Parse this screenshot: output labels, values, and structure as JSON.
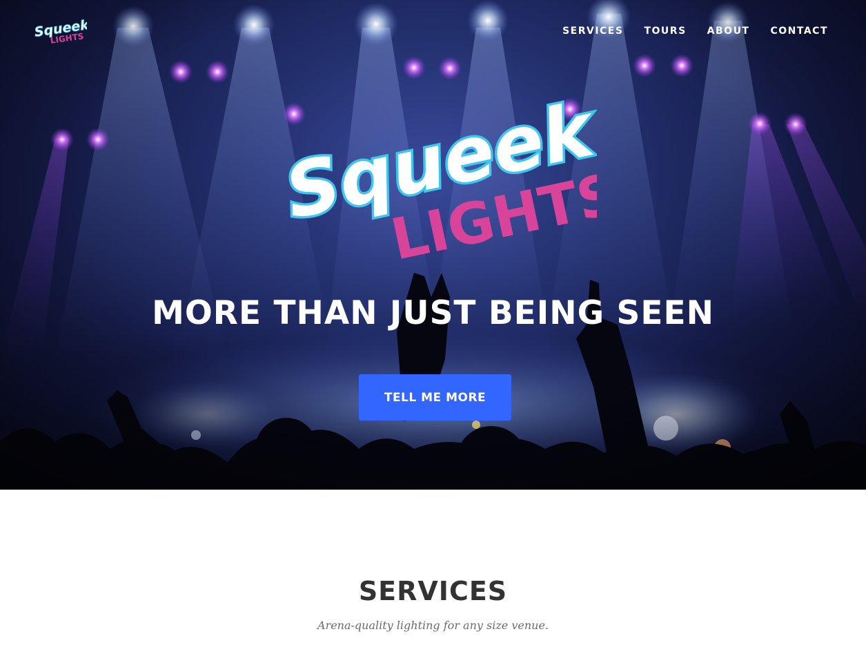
{
  "nav": {
    "logo": {
      "word1": "Squeek",
      "word2": "LIGHTS"
    },
    "links": [
      {
        "label": "SERVICES"
      },
      {
        "label": "TOURS"
      },
      {
        "label": "ABOUT"
      },
      {
        "label": "CONTACT"
      }
    ]
  },
  "hero": {
    "logo": {
      "word1": "Squeek",
      "word2": "LIGHTS"
    },
    "heading": "MORE THAN JUST BEING SEEN",
    "cta_label": "TELL ME MORE"
  },
  "services": {
    "title": "SERVICES",
    "subtitle": "Arena-quality lighting for any size venue."
  },
  "colors": {
    "accent": "#3366ff",
    "logo_cyan": "#3ec6ef",
    "logo_pink": "#d9449b",
    "hero_dark": "#0a0d26"
  },
  "icons": {
    "hero_background": "concert-crowd-stage-lights-image"
  }
}
